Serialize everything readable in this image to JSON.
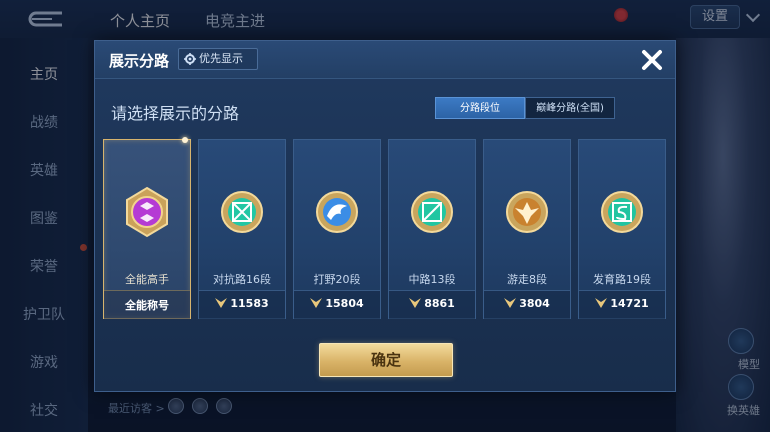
{
  "background": {
    "header_tabs": [
      "个人主页",
      "电竞主进"
    ],
    "settings_label": "设置",
    "sidebar_items": [
      "主页",
      "战绩",
      "英雄",
      "图鉴",
      "荣誉",
      "护卫队",
      "游戏",
      "社交"
    ],
    "right_labels": {
      "model": "模型",
      "switch_hero": "换英雄"
    },
    "bottom_text": "最近访客 >"
  },
  "dialog": {
    "title": "展示分路",
    "priority_button": "优先显示",
    "subtitle": "请选择展示的分路",
    "tabs": [
      {
        "label": "分路段位",
        "active": true
      },
      {
        "label": "巅峰分路(全国)",
        "active": false
      }
    ],
    "cards": [
      {
        "name": "全能高手",
        "footer": "全能称号",
        "selected": true,
        "emblem_color": "#b53bd4",
        "has_score": false
      },
      {
        "name": "对抗路16段",
        "score": "11583",
        "selected": false,
        "emblem_color": "#21c7a4",
        "has_score": true
      },
      {
        "name": "打野20段",
        "score": "15804",
        "selected": false,
        "emblem_color": "#3b8de6",
        "has_score": true
      },
      {
        "name": "中路13段",
        "score": "8861",
        "selected": false,
        "emblem_color": "#20c6a2",
        "has_score": true
      },
      {
        "name": "游走8段",
        "score": "3804",
        "selected": false,
        "emblem_color": "#c9822f",
        "has_score": true
      },
      {
        "name": "发育路19段",
        "score": "14721",
        "selected": false,
        "emblem_color": "#22c4a0",
        "has_score": true
      }
    ],
    "confirm_button": "确定"
  },
  "colors": {
    "accent_gold": "#d9b368",
    "tab_active": "#2c63a6",
    "panel": "#1c3354"
  }
}
